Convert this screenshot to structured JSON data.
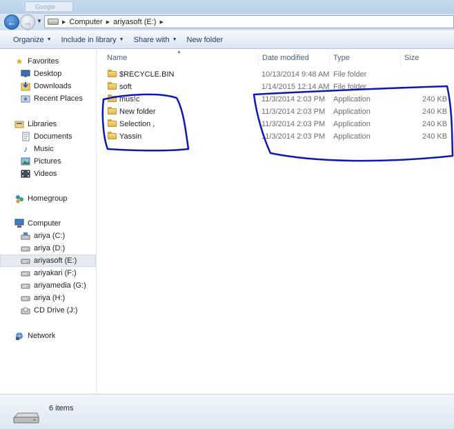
{
  "window": {
    "ghost_tab_label": "Google"
  },
  "addressbar": {
    "crumbs": [
      "Computer",
      "ariyasoft (E:)"
    ]
  },
  "toolbar": {
    "organize": "Organize",
    "include_in_library": "Include in library",
    "share_with": "Share with",
    "new_folder": "New folder"
  },
  "sidebar": {
    "favorites": {
      "label": "Favorites",
      "items": [
        "Desktop",
        "Downloads",
        "Recent Places"
      ]
    },
    "libraries": {
      "label": "Libraries",
      "items": [
        "Documents",
        "Music",
        "Pictures",
        "Videos"
      ]
    },
    "homegroup": {
      "label": "Homegroup"
    },
    "computer": {
      "label": "Computer",
      "items": [
        "ariya (C:)",
        "ariya (D:)",
        "ariyasoft (E:)",
        "ariyakari (F:)",
        "ariyamedia (G:)",
        "ariya (H:)",
        "CD Drive (J:)"
      ]
    },
    "network": {
      "label": "Network"
    }
  },
  "columns": {
    "name": "Name",
    "date_modified": "Date modified",
    "type": "Type",
    "size": "Size"
  },
  "files": [
    {
      "name": "$RECYCLE.BIN",
      "date": "10/13/2014 9:48 AM",
      "type": "File folder",
      "size": ""
    },
    {
      "name": "soft",
      "date": "1/14/2015 12:14 AM",
      "type": "File folder",
      "size": ""
    },
    {
      "name": "mus!c",
      "date": "11/3/2014 2:03 PM",
      "type": "Application",
      "size": "240 KB"
    },
    {
      "name": "New folder",
      "date": "11/3/2014 2:03 PM",
      "type": "Application",
      "size": "240 KB"
    },
    {
      "name": "Selection ,",
      "date": "11/3/2014 2:03 PM",
      "type": "Application",
      "size": "240 KB"
    },
    {
      "name": "Yassin",
      "date": "11/3/2014 2:03 PM",
      "type": "Application",
      "size": "240 KB"
    }
  ],
  "status": {
    "count": "6 items"
  },
  "colors": {
    "annotation": "#0a14c8",
    "selected_row": "#e5eaf1",
    "toolbar_text": "#1e395b"
  }
}
